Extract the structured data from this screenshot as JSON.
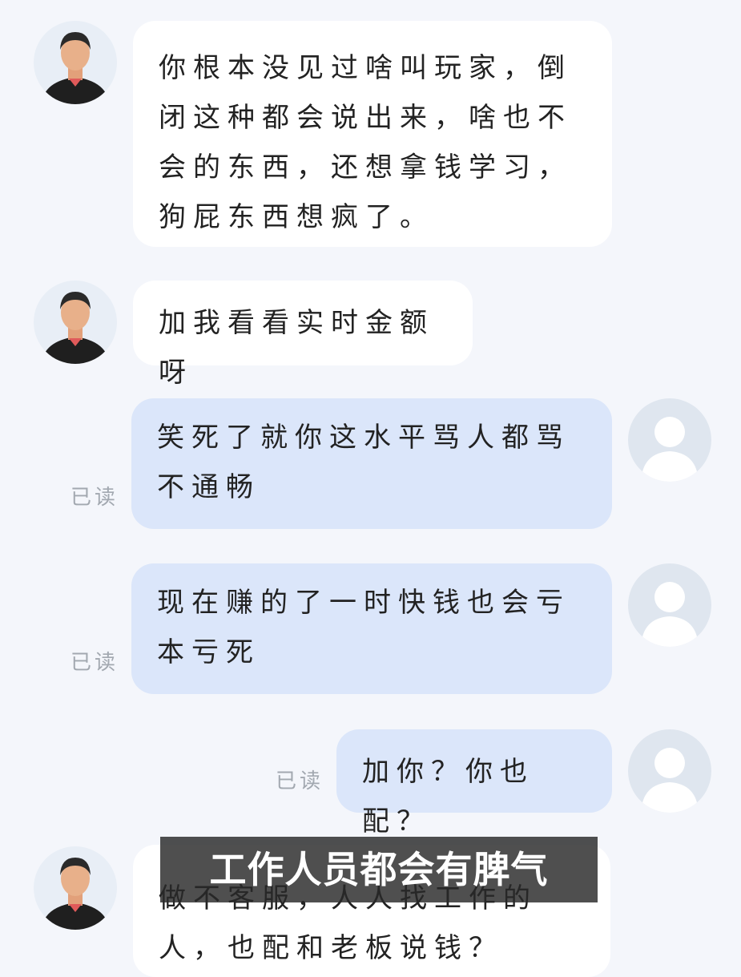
{
  "messages": [
    {
      "text": "你根本没见过啥叫玩家，倒闭这种都会说出来，啥也不会的东西，还想拿钱学习，狗屁东西想疯了。"
    },
    {
      "text": "加我看看实时金额呀"
    },
    {
      "text": "笑死了就你这水平骂人都骂不通畅",
      "status": "已读"
    },
    {
      "text": "现在赚的了一时快钱也会亏本亏死",
      "status": "已读"
    },
    {
      "text": "加你？你也配？",
      "status": "已读"
    },
    {
      "text": "做不客服，人人找工作的人，也配和老板说钱？"
    }
  ],
  "caption": "工作人员都会有脾气"
}
